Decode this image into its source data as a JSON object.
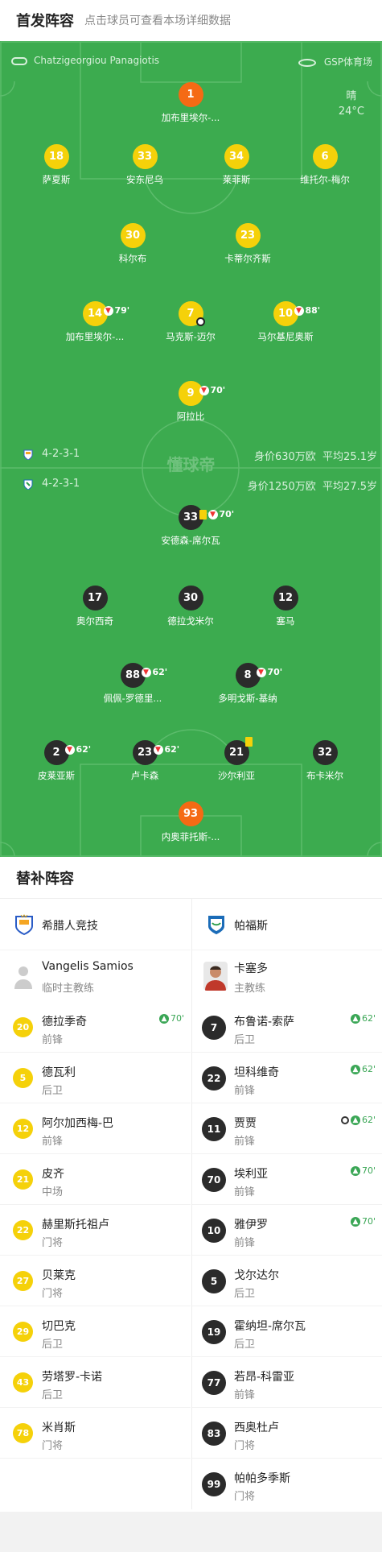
{
  "header": {
    "title": "首发阵容",
    "subtitle": "点击球员可查看本场详细数据"
  },
  "pitch": {
    "referee": "Chatzigeorgiou Panagiotis",
    "venue": "GSP体育场",
    "weather": "晴",
    "temperature": "24°C",
    "watermark": "懂球帝",
    "home_formation": "4-2-3-1",
    "away_formation": "4-2-3-1",
    "home_value": "身价630万欧",
    "home_age": "平均25.1岁",
    "away_value": "身价1250万欧",
    "away_age": "平均27.5岁"
  },
  "home_players": [
    {
      "num": "1",
      "name": "加布里埃尔-...",
      "gk": true
    },
    {
      "num": "18",
      "name": "萨夏斯"
    },
    {
      "num": "33",
      "name": "安东尼乌"
    },
    {
      "num": "34",
      "name": "莱菲斯"
    },
    {
      "num": "6",
      "name": "维托尔-梅尔"
    },
    {
      "num": "30",
      "name": "科尔布"
    },
    {
      "num": "23",
      "name": "卡蒂尔齐斯"
    },
    {
      "num": "14",
      "name": "加布里埃尔-...",
      "sub_out": "79'"
    },
    {
      "num": "7",
      "name": "马克斯-迈尔",
      "goal": true
    },
    {
      "num": "10",
      "name": "马尔基尼奥斯",
      "sub_out": "88'"
    },
    {
      "num": "9",
      "name": "阿拉比",
      "sub_out": "70'"
    }
  ],
  "away_players": [
    {
      "num": "33",
      "name": "安德森-席尔瓦",
      "yellow": true,
      "sub_out": "70'"
    },
    {
      "num": "17",
      "name": "奥尔西奇"
    },
    {
      "num": "30",
      "name": "德拉戈米尔"
    },
    {
      "num": "12",
      "name": "塞马"
    },
    {
      "num": "88",
      "name": "佩佩-罗德里...",
      "sub_out": "62'"
    },
    {
      "num": "8",
      "name": "多明戈斯-基纳",
      "sub_out": "70'"
    },
    {
      "num": "2",
      "name": "皮莱亚斯",
      "sub_out": "62'"
    },
    {
      "num": "23",
      "name": "卢卡森",
      "sub_out": "62'"
    },
    {
      "num": "21",
      "name": "沙尔利亚",
      "yellow": true
    },
    {
      "num": "32",
      "name": "布卡米尔"
    },
    {
      "num": "93",
      "name": "内奥菲托斯-...",
      "gk": true
    }
  ],
  "subs": {
    "title": "替补阵容",
    "home": {
      "team": "希腊人竞技",
      "coach": "Vangelis Samios",
      "coach_role": "临时主教练",
      "players": [
        {
          "num": "20",
          "name": "德拉季奇",
          "pos": "前锋",
          "event": "70'"
        },
        {
          "num": "5",
          "name": "德瓦利",
          "pos": "后卫"
        },
        {
          "num": "12",
          "name": "阿尔加西梅-巴",
          "pos": "前锋"
        },
        {
          "num": "21",
          "name": "皮齐",
          "pos": "中场"
        },
        {
          "num": "22",
          "name": "赫里斯托祖卢",
          "pos": "门将"
        },
        {
          "num": "27",
          "name": "贝莱克",
          "pos": "门将"
        },
        {
          "num": "29",
          "name": "切巴克",
          "pos": "后卫"
        },
        {
          "num": "43",
          "name": "劳塔罗-卡诺",
          "pos": "后卫"
        },
        {
          "num": "78",
          "name": "米肖斯",
          "pos": "门将"
        }
      ]
    },
    "away": {
      "team": "帕福斯",
      "coach": "卡塞多",
      "coach_role": "主教练",
      "players": [
        {
          "num": "7",
          "name": "布鲁诺-索萨",
          "pos": "后卫",
          "event": "62'"
        },
        {
          "num": "22",
          "name": "坦科维奇",
          "pos": "前锋",
          "event": "62'"
        },
        {
          "num": "11",
          "name": "贾贾",
          "pos": "前锋",
          "event": "62'",
          "goal": true
        },
        {
          "num": "70",
          "name": "埃利亚",
          "pos": "前锋",
          "event": "70'"
        },
        {
          "num": "10",
          "name": "雅伊罗",
          "pos": "前锋",
          "event": "70'"
        },
        {
          "num": "5",
          "name": "戈尔达尔",
          "pos": "后卫"
        },
        {
          "num": "19",
          "name": "霍纳坦-席尔瓦",
          "pos": "后卫"
        },
        {
          "num": "77",
          "name": "若昂-科雷亚",
          "pos": "前锋"
        },
        {
          "num": "83",
          "name": "西奥杜卢",
          "pos": "门将"
        },
        {
          "num": "99",
          "name": "帕帕多季斯",
          "pos": "门将"
        }
      ]
    }
  },
  "colors": {
    "pitch": "#3cab4f",
    "home": "#f5d10a",
    "away": "#2b2b2b",
    "gk_home": "#f56a14"
  }
}
